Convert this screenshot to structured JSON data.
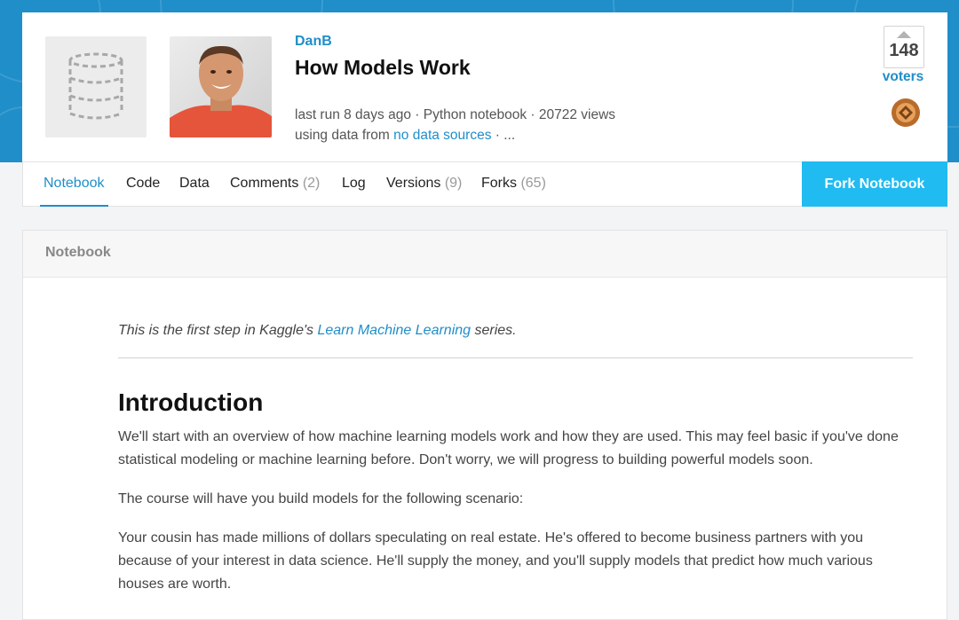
{
  "notebook": {
    "author": "DanB",
    "title": "How Models Work",
    "meta_line1": "last run 8 days ago · Python notebook · 20722 views",
    "meta_line2_prefix": "using data from ",
    "meta_line2_link": "no data sources",
    "meta_line2_suffix": " · ...",
    "votes": "148",
    "votes_label": "voters"
  },
  "tabs": [
    {
      "label": "Notebook",
      "count": ""
    },
    {
      "label": "Code",
      "count": ""
    },
    {
      "label": "Data",
      "count": ""
    },
    {
      "label": "Comments",
      "count": "(2)"
    },
    {
      "label": "Log",
      "count": ""
    },
    {
      "label": "Versions",
      "count": "(9)"
    },
    {
      "label": "Forks",
      "count": "(65)"
    }
  ],
  "fork_button": "Fork Notebook",
  "panel": {
    "header": "Notebook",
    "intro_prefix": "This is the first step in Kaggle's ",
    "intro_link": "Learn Machine Learning",
    "intro_suffix": " series.",
    "heading": "Introduction",
    "paragraphs": [
      "We'll start with an overview of how machine learning models work and how they are used. This may feel basic if you've done statistical modeling or machine learning before. Don't worry, we will progress to building powerful models soon.",
      "The course will have you build models for the following scenario:",
      "Your cousin has made millions of dollars speculating on real estate. He's offered to become business partners with you because of your interest in data science. He'll supply the money, and you'll supply models that predict how much various houses are worth."
    ]
  },
  "colors": {
    "banner": "#1f8ec9",
    "accent": "#1f8ec9",
    "fork_button": "#20bbf1",
    "medal": "#b86b2b"
  },
  "icons": {
    "dataset": "database-icon",
    "upvote": "upvote-arrow-icon",
    "medal": "bronze-medal-icon"
  }
}
